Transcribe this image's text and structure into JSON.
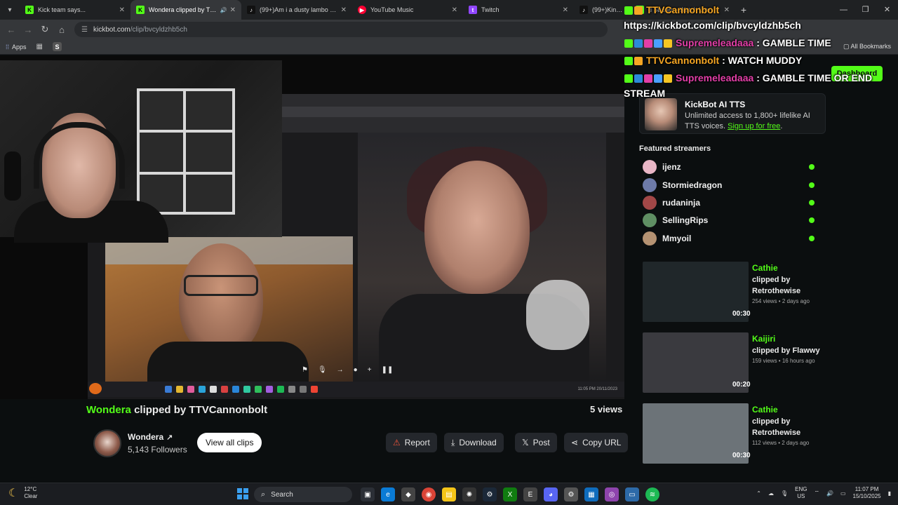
{
  "tabs": [
    {
      "title": "Kick team says...",
      "favicon": "kick-icon",
      "color": "#53fc18"
    },
    {
      "title": "Wondera clipped by TTVCa",
      "favicon": "kick-icon",
      "color": "#53fc18",
      "active": true
    },
    {
      "title": "(99+)Am i a dusty lambo too?",
      "favicon": "tiktok-icon",
      "color": "#ffffff"
    },
    {
      "title": "YouTube Music",
      "favicon": "youtube-music-icon",
      "color": "#ff0033"
    },
    {
      "title": "Twitch",
      "favicon": "twitch-icon",
      "color": "#9146ff"
    },
    {
      "title": "(99+)KingChie",
      "favicon": "tiktok-icon",
      "color": "#ffffff"
    },
    {
      "title": "d Stream - Watch Live",
      "favicon": "kick-icon",
      "color": "#53fc18"
    }
  ],
  "toolbar": {
    "url_host": "kickbot.com",
    "url_path": "/clip/bvcyldzhb5ch"
  },
  "bookmarks": {
    "apps": "Apps",
    "all": "All Bookmarks"
  },
  "overlay_chat": [
    {
      "user": "TTVCannonbolt",
      "message": "",
      "user_color": "#f5a623"
    },
    {
      "user": "",
      "message": "https://kickbot.com/clip/bvcyldzhb5ch",
      "user_color": "#ffffff"
    },
    {
      "user": "Supremeleadaaa",
      "message": ": GAMBLE TIME",
      "user_color": "#e23ea7"
    },
    {
      "user": "TTVCannonbolt",
      "message": ": WATCH MUDDY",
      "user_color": "#f5a623"
    },
    {
      "user": "Supremeleadaaa",
      "message": ": GAMBLE TIME OR END",
      "user_color": "#e23ea7"
    },
    {
      "user": "",
      "message": "STREAM",
      "user_color": "#ffffff"
    }
  ],
  "clip": {
    "streamer": "Wondera",
    "clipped_by": "clipped by TTVCannonbolt",
    "views": "5 views"
  },
  "channel": {
    "name": "Wondera",
    "followers": "5,143 Followers",
    "view_all": "View all clips"
  },
  "actions": {
    "report": "Report",
    "download": "Download",
    "post": "Post",
    "copy_url": "Copy URL"
  },
  "sidebar": {
    "dashboard": "Dashboard",
    "tts_title": "KickBot AI TTS",
    "tts_desc": "Unlimited access to 1,800+ lifelike AI TTS voices.",
    "tts_link": "Sign up for free",
    "featured_heading": "Featured streamers",
    "streamers": [
      {
        "name": "ijenz",
        "color": "#e9b6c6"
      },
      {
        "name": "Stormiedragon",
        "color": "#6d7aa8"
      },
      {
        "name": "rudaninja",
        "color": "#a24747"
      },
      {
        "name": "SellingRips",
        "color": "#5f8f63"
      },
      {
        "name": "Mmyoil",
        "color": "#b59272"
      }
    ],
    "related": [
      {
        "name": "Cathie",
        "by": "clipped by Retrothewise",
        "meta": "254 views • 2 days ago",
        "duration": "00:30",
        "thumb": "#20272a"
      },
      {
        "name": "Kaijiri",
        "by": "clipped by Flawwy",
        "meta": "159 views • 16 hours ago",
        "duration": "00:20",
        "thumb": "#3a3a3f"
      },
      {
        "name": "Cathie",
        "by": "clipped by Retrothewise",
        "meta": "112 views • 2 days ago",
        "duration": "00:30",
        "thumb": "#6c7378"
      }
    ]
  },
  "taskbar": {
    "temp": "12°C",
    "condition": "Clear",
    "search": "Search",
    "lang": "ENG",
    "region": "US",
    "time": "11:07 PM",
    "date": "15/10/2025"
  },
  "video": {
    "inner_time": "11:05 PM",
    "inner_date": "20/11/2023"
  }
}
